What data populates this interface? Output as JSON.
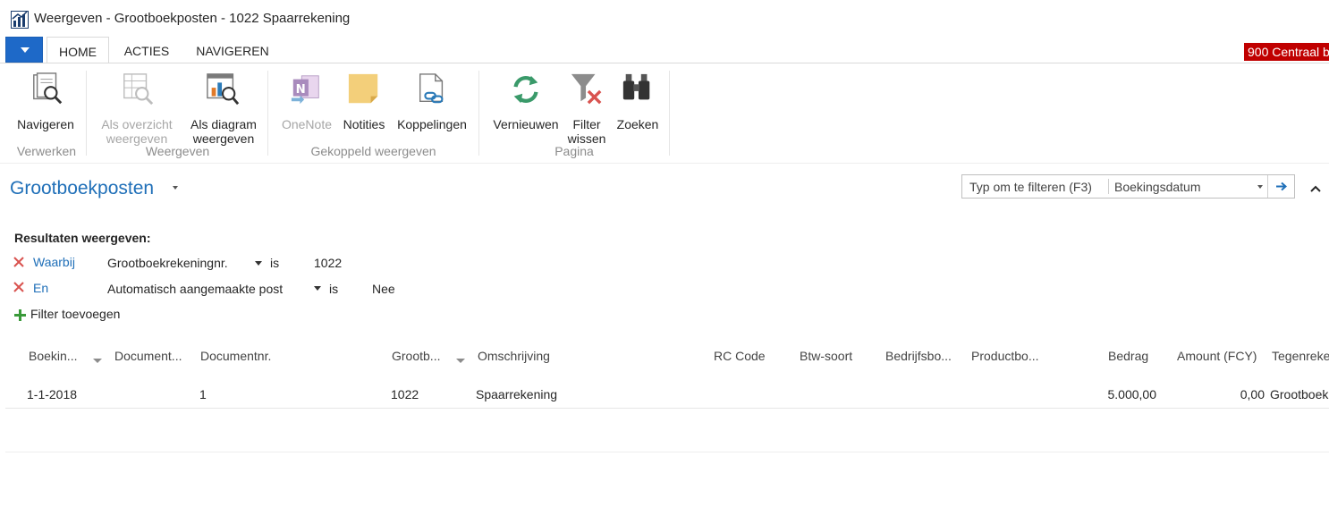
{
  "window": {
    "title": "Weergeven - Grootboekposten - 1022 Spaarrekening"
  },
  "menu": {
    "tabs": [
      {
        "label": "HOME",
        "active": true
      },
      {
        "label": "ACTIES",
        "active": false
      },
      {
        "label": "NAVIGEREN",
        "active": false
      }
    ],
    "company": "900 Centraal b"
  },
  "ribbon": {
    "groups": [
      {
        "label": "Verwerken",
        "buttons": [
          {
            "label": "Navigeren",
            "icon": "navigate-icon",
            "enabled": true
          }
        ]
      },
      {
        "label": "Weergeven",
        "buttons": [
          {
            "label_line1": "Als overzicht",
            "label_line2": "weergeven",
            "icon": "list-view-icon",
            "enabled": false
          },
          {
            "label_line1": "Als diagram",
            "label_line2": "weergeven",
            "icon": "chart-view-icon",
            "enabled": true
          }
        ]
      },
      {
        "label": "Gekoppeld weergeven",
        "buttons": [
          {
            "label": "OneNote",
            "icon": "onenote-icon",
            "enabled": false
          },
          {
            "label": "Notities",
            "icon": "notes-icon",
            "enabled": true
          },
          {
            "label": "Koppelingen",
            "icon": "links-icon",
            "enabled": true
          }
        ]
      },
      {
        "label": "Pagina",
        "buttons": [
          {
            "label": "Vernieuwen",
            "icon": "refresh-icon",
            "enabled": true
          },
          {
            "label_line1": "Filter",
            "label_line2": "wissen",
            "icon": "clear-filter-icon",
            "enabled": true
          },
          {
            "label": "Zoeken",
            "icon": "binoculars-icon",
            "enabled": true
          }
        ]
      }
    ]
  },
  "page": {
    "title": "Grootboekposten",
    "filter_placeholder": "Typ om te filteren (F3)",
    "filter_field": "Boekingsdatum"
  },
  "filters": {
    "title": "Resultaten weergeven:",
    "rows": [
      {
        "conjunction": "Waarbij",
        "field": "Grootboekrekeningnr.",
        "operator": "is",
        "value": "1022"
      },
      {
        "conjunction": "En",
        "field": "Automatisch aangemaakte post",
        "operator": "is",
        "value": "Nee"
      }
    ],
    "add_label": "Filter toevoegen"
  },
  "table": {
    "columns": [
      "Boekin...",
      "Document...",
      "Documentnr.",
      "Grootb...",
      "Omschrijving",
      "RC Code",
      "Btw-soort",
      "Bedrijfsbo...",
      "Productbo...",
      "Bedrag",
      "Amount (FCY)",
      "Tegenreke"
    ],
    "rows": [
      [
        "1-1-2018",
        "",
        "1",
        "1022",
        "Spaarrekening",
        "",
        "",
        "",
        "",
        "5.000,00",
        "0,00",
        "Grootboek"
      ]
    ]
  },
  "colors": {
    "accent": "#1f6fb8",
    "menu_button": "#1e69c8",
    "company_badge": "#c00000",
    "remove_filter": "#d9534f",
    "add_filter": "#3a9a3a"
  }
}
